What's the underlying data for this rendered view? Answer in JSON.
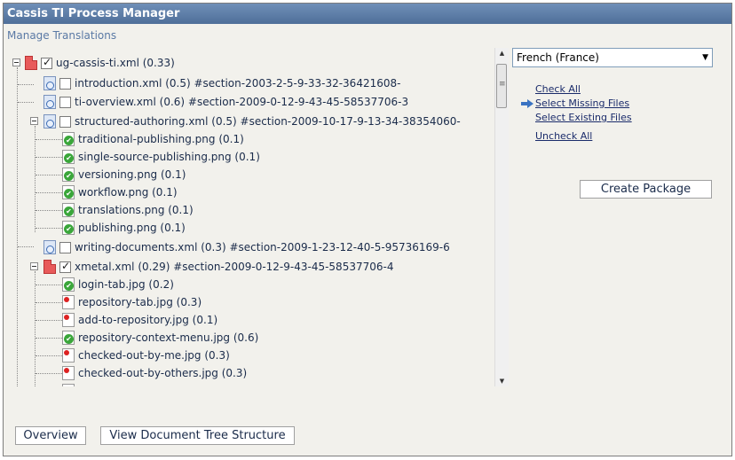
{
  "window": {
    "title": "Cassis TI Process Manager"
  },
  "header": {
    "subtitle": "Manage Translations"
  },
  "tree": {
    "nodes": [
      {
        "label": "ug-cassis-ti.xml (0.33)"
      },
      {
        "label": "introduction.xml (0.5) #section-2003-2-5-9-33-32-36421608-"
      },
      {
        "label": "ti-overview.xml (0.6) #section-2009-0-12-9-43-45-58537706-3"
      },
      {
        "label": "structured-authoring.xml (0.5) #section-2009-10-17-9-13-34-38354060-"
      },
      {
        "label": "traditional-publishing.png (0.1)"
      },
      {
        "label": "single-source-publishing.png (0.1)"
      },
      {
        "label": "versioning.png (0.1)"
      },
      {
        "label": "workflow.png (0.1)"
      },
      {
        "label": "translations.png (0.1)"
      },
      {
        "label": "publishing.png (0.1)"
      },
      {
        "label": "writing-documents.xml (0.3) #section-2009-1-23-12-40-5-95736169-6"
      },
      {
        "label": "xmetal.xml (0.29) #section-2009-0-12-9-43-45-58537706-4"
      },
      {
        "label": "login-tab.jpg (0.2)"
      },
      {
        "label": "repository-tab.jpg (0.3)"
      },
      {
        "label": "add-to-repository.jpg (0.1)"
      },
      {
        "label": "repository-context-menu.jpg (0.6)"
      },
      {
        "label": "checked-out-by-me.jpg (0.3)"
      },
      {
        "label": "checked-out-by-others.jpg (0.3)"
      }
    ]
  },
  "language": {
    "selected": "French (France)"
  },
  "actions": {
    "check_all": "Check All",
    "select_missing": "Select Missing Files",
    "select_existing": "Select Existing Files",
    "uncheck_all": "Uncheck All",
    "create_package": "Create Package"
  },
  "footer": {
    "overview": "Overview",
    "view_tree": "View Document Tree Structure"
  },
  "colors": {
    "titlebar": "#5a7aa6",
    "background": "#f2f1ec",
    "link": "#1a2b6a",
    "accent": "#3a73c2"
  }
}
